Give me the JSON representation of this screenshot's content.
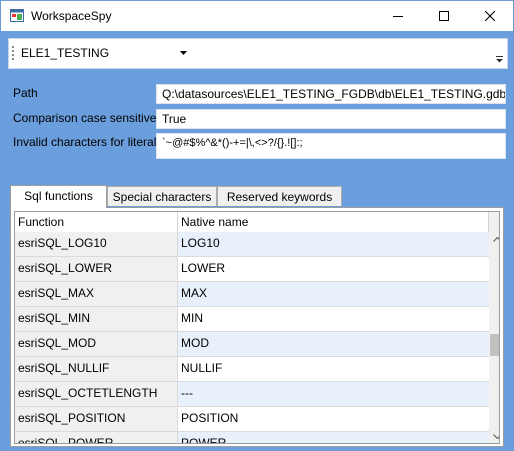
{
  "window": {
    "title": "WorkspaceSpy"
  },
  "toolbar": {
    "workspace_selected": "ELE1_TESTING"
  },
  "properties": {
    "path_label": "Path",
    "path_value": "Q:\\datasources\\ELE1_TESTING_FGDB\\db\\ELE1_TESTING.gdb",
    "case_label": "Comparison case sensitive",
    "case_value": "True",
    "invalid_label": "Invalid characters for literals",
    "invalid_value": "`~@#$%^&*()-+=|\\,<>?/{}.![]:;"
  },
  "tabs": [
    {
      "label": "Sql functions",
      "active": true
    },
    {
      "label": "Special characters",
      "active": false
    },
    {
      "label": "Reserved keywords",
      "active": false
    }
  ],
  "grid": {
    "columns": [
      "Function",
      "Native name"
    ],
    "rows": [
      [
        "esriSQL_LOG10",
        "LOG10"
      ],
      [
        "esriSQL_LOWER",
        "LOWER"
      ],
      [
        "esriSQL_MAX",
        "MAX"
      ],
      [
        "esriSQL_MIN",
        "MIN"
      ],
      [
        "esriSQL_MOD",
        "MOD"
      ],
      [
        "esriSQL_NULLIF",
        "NULLIF"
      ],
      [
        "esriSQL_OCTETLENGTH",
        "---"
      ],
      [
        "esriSQL_POSITION",
        "POSITION"
      ],
      [
        "esriSQL_POWER",
        "POWER"
      ]
    ]
  },
  "icons": {
    "app": "app-window-icon",
    "minimize": "minimize-icon",
    "maximize": "maximize-icon",
    "close": "close-icon"
  },
  "colors": {
    "client_background": "#6a9edc",
    "alt_row": "#e8f1fb",
    "function_column": "#f0f0f0"
  }
}
